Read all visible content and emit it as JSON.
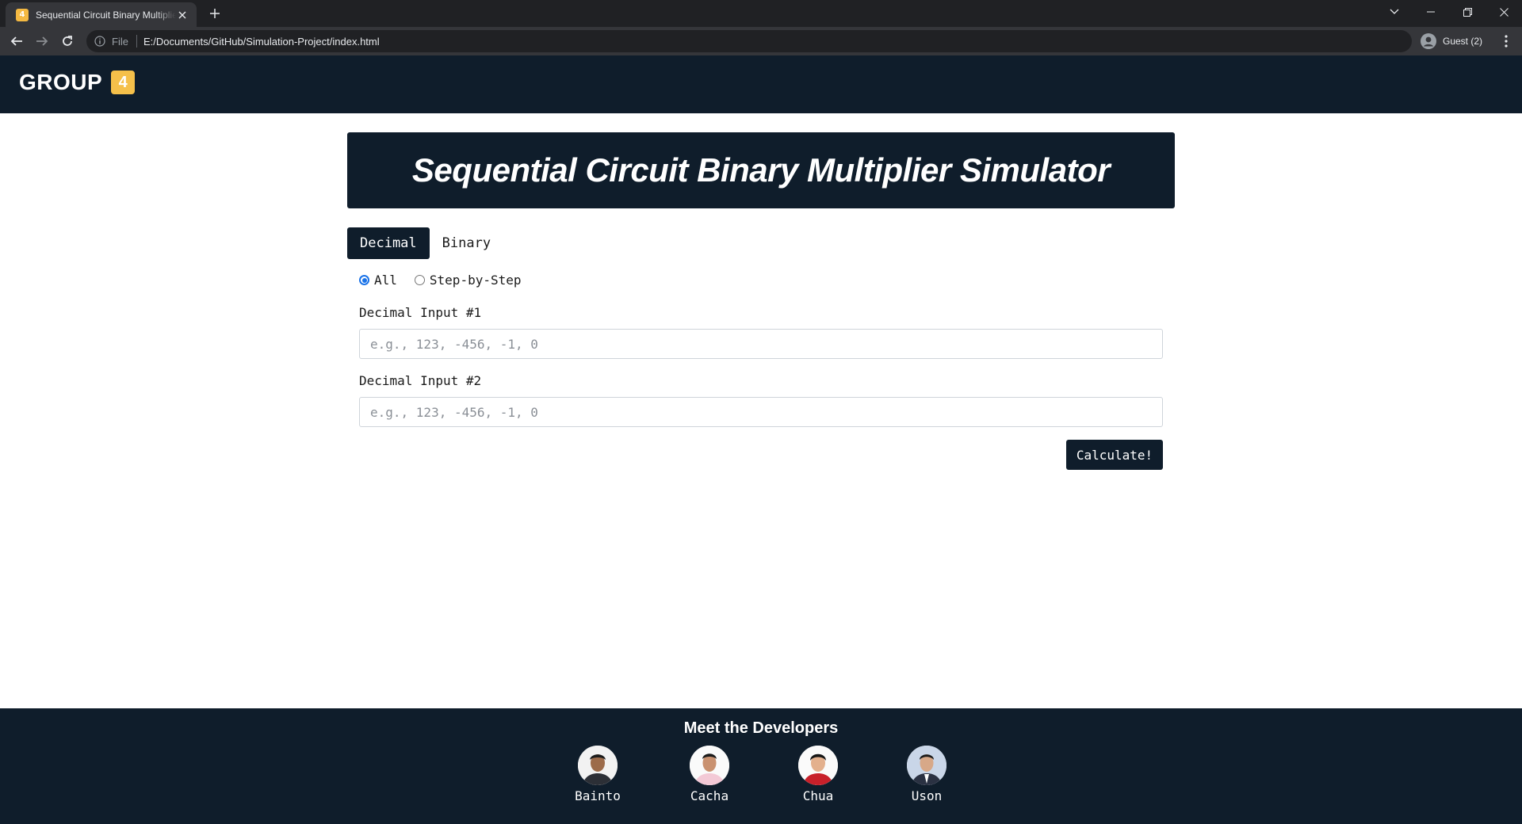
{
  "browser": {
    "tab_title": "Sequential Circuit Binary Multiplier Simulator",
    "tab_favicon_text": "4",
    "omnibox_scheme": "File",
    "omnibox_url": "E:/Documents/GitHub/Simulation-Project/index.html",
    "profile_label": "Guest (2)"
  },
  "header": {
    "brand": "GROUP",
    "badge": "4",
    "badge_color": "#f5c04a",
    "bg_color": "#0f1d2b"
  },
  "hero": {
    "title": "Sequential Circuit Binary Multiplier Simulator"
  },
  "mode_tabs": [
    {
      "label": "Decimal",
      "active": true
    },
    {
      "label": "Binary",
      "active": false
    }
  ],
  "display_options": [
    {
      "label": "All",
      "checked": true
    },
    {
      "label": "Step-by-Step",
      "checked": false
    }
  ],
  "form": {
    "input1_label": "Decimal Input #1",
    "input1_placeholder": "e.g., 123, -456, -1, 0",
    "input1_value": "",
    "input2_label": "Decimal Input #2",
    "input2_placeholder": "e.g., 123, -456, -1, 0",
    "input2_value": "",
    "calculate_label": "Calculate!"
  },
  "footer": {
    "title": "Meet the Developers",
    "developers": [
      {
        "name": "Bainto"
      },
      {
        "name": "Cacha"
      },
      {
        "name": "Chua"
      },
      {
        "name": "Uson"
      }
    ]
  }
}
